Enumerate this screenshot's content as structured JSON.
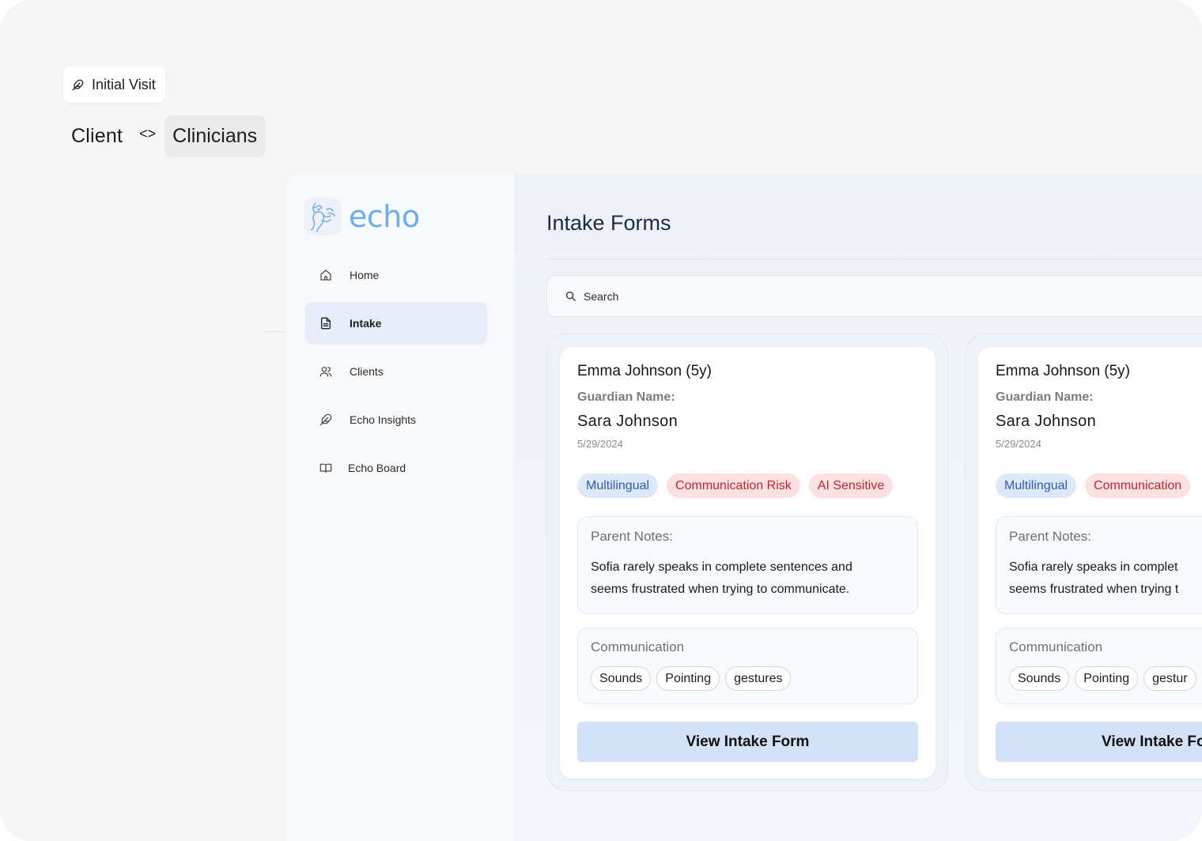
{
  "header": {
    "visit_pill_icon": "feather-icon",
    "visit_pill_label": "Initial Visit",
    "role_left": "Client",
    "role_separator": "<>",
    "role_right": "Clinicians"
  },
  "sidebar": {
    "logo_text": "echo",
    "logo_icon": "bird-hand-logo",
    "items": [
      {
        "label": "Home",
        "icon": "home-icon",
        "active": false
      },
      {
        "label": "Intake",
        "icon": "document-icon",
        "active": true
      },
      {
        "label": "Clients",
        "icon": "users-icon",
        "active": false
      },
      {
        "label": "Echo Insights",
        "icon": "feather-icon",
        "active": false
      },
      {
        "label": "Echo Board",
        "icon": "book-icon",
        "active": false
      }
    ]
  },
  "main": {
    "title": "Intake Forms",
    "search_placeholder": "Search"
  },
  "cards": [
    {
      "name": "Emma Johnson (5y)",
      "guardian_label": "Guardian Name:",
      "guardian_name": "Sara Johnson",
      "date": "5/29/2024",
      "tags": [
        {
          "label": "Multilingual",
          "color": "#2f5bb0"
        },
        {
          "label": "Communication Risk",
          "color": "#c8252a"
        },
        {
          "label": "AI Sensitive",
          "color": "#c8252a"
        }
      ],
      "notes_label": "Parent Notes:",
      "notes_line1": "Sofia rarely speaks in complete sentences and",
      "notes_line2": "seems frustrated when trying to communicate.",
      "comm_label": "Communication",
      "comm_chips": [
        "Sounds",
        "Pointing",
        "gestures"
      ],
      "button_label": "View Intake Form"
    },
    {
      "name": "Emma Johnson (5y)",
      "guardian_label": "Guardian Name:",
      "guardian_name": "Sara Johnson",
      "date": "5/29/2024",
      "tags": [
        {
          "label": "Multilingual",
          "color": "#2f5bb0"
        },
        {
          "label": "Communication",
          "color": "#c8252a"
        }
      ],
      "notes_label": "Parent Notes:",
      "notes_line1": "Sofia rarely speaks in complet",
      "notes_line2": "seems frustrated when trying t",
      "comm_label": "Communication",
      "comm_chips": [
        "Sounds",
        "Pointing",
        "gestur"
      ],
      "button_label": "View Intake Fo"
    }
  ],
  "colors": {
    "accent_blue": "#6aaeef",
    "button_bg": "#d3e2f8",
    "tag_blue_bg": "#dde8f8",
    "tag_red_bg": "#fbe1e1"
  }
}
